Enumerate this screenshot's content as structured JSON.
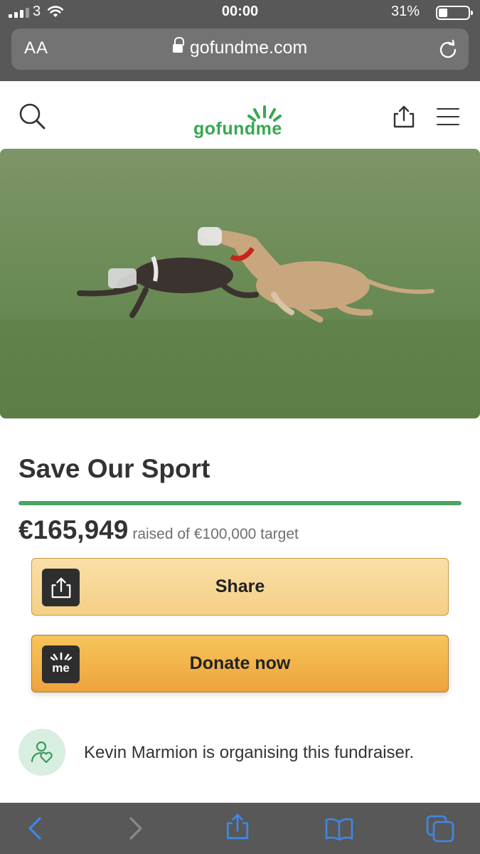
{
  "status_bar": {
    "carrier": "3",
    "time": "00:00",
    "battery": "31%"
  },
  "browser": {
    "text_size_label": "AA",
    "url": "gofundme.com"
  },
  "site": {
    "logo_text": "gofundme"
  },
  "campaign": {
    "title": "Save Our Sport",
    "raised": "€165,949",
    "target_text": "raised of €100,000 target",
    "progress_fraction": 1.0,
    "share_label": "Share",
    "donate_label": "Donate now",
    "organiser_text": "Kevin Marmion is organising this fundraiser."
  },
  "icons": {
    "search": "search-icon",
    "share": "share-icon",
    "menu": "menu-icon",
    "heart_user": "user-heart-icon",
    "back": "back-arrow-icon",
    "forward": "forward-arrow-icon",
    "bookmarks": "book-icon",
    "tabs": "tabs-icon"
  },
  "colors": {
    "brand_green": "#36a852",
    "progress_green": "#4aa564",
    "donate_orange": "#f0ad45",
    "share_yellow": "#f7d899",
    "ios_chrome": "#585858",
    "ios_blue": "#3d88e8"
  }
}
